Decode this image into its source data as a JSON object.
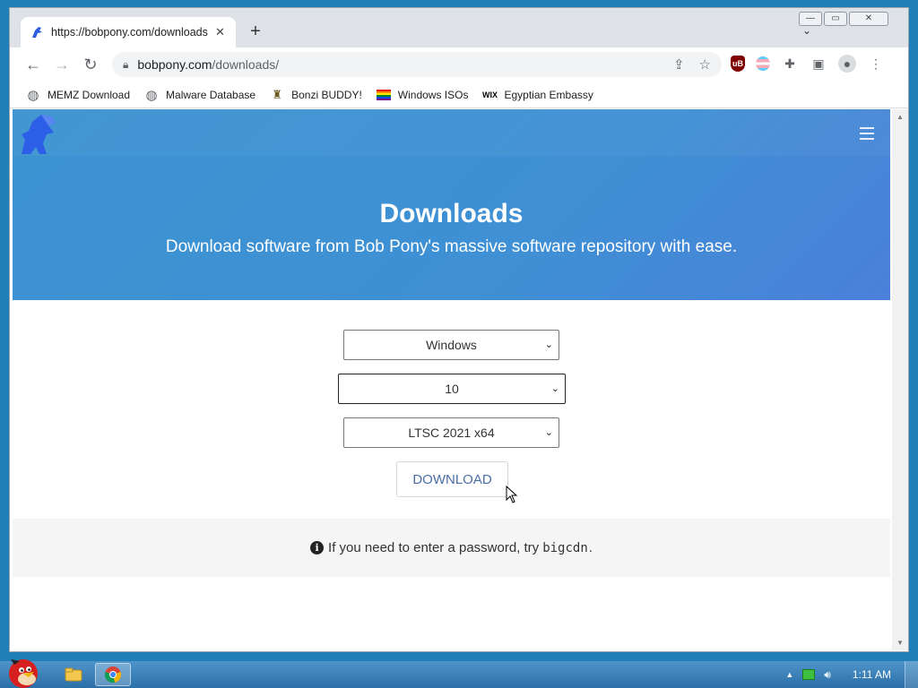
{
  "browser": {
    "tab_title": "https://bobpony.com/downloads",
    "tab_close": "✕",
    "new_tab": "+",
    "url_host": "bobpony.com",
    "url_path": "/downloads/",
    "window_controls": {
      "minimize": "—",
      "restore": "▭",
      "close": "✕"
    }
  },
  "bookmarks": [
    {
      "label": "MEMZ Download",
      "icon": "globe-icon"
    },
    {
      "label": "Malware Database",
      "icon": "globe-icon"
    },
    {
      "label": "Bonzi BUDDY!",
      "icon": "bonzi-icon"
    },
    {
      "label": "Windows ISOs",
      "icon": "rainbow-flag-icon"
    },
    {
      "label": "Egyptian Embassy",
      "icon": "wix-icon"
    }
  ],
  "page": {
    "title": "Downloads",
    "subtitle": "Download software from Bob Pony's massive software repository with ease.",
    "selects": {
      "os": "Windows",
      "version": "10",
      "edition": "LTSC 2021 x64"
    },
    "download_label": "DOWNLOAD",
    "info": {
      "before": "If you need to enter a password, try",
      "code": "bigcdn",
      "after": "."
    }
  },
  "taskbar": {
    "clock": "1:11 AM"
  },
  "colors": {
    "hero_blue": "#3f90d4",
    "button_text": "#4a6fa5",
    "desktop_blue": "#1f7fb6"
  }
}
